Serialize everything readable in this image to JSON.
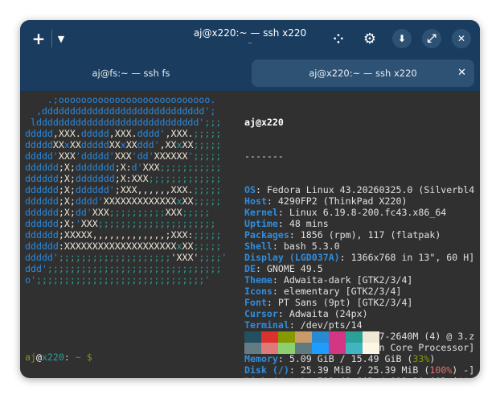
{
  "window": {
    "title": "aj@x220:~ — ssh x220",
    "subtitle": "~"
  },
  "toolbar": {
    "new_tab": "+",
    "menu": "▼",
    "grid": "⁘",
    "settings": "⚙",
    "download": "⬇",
    "fullscreen": "⤢",
    "close": "✕"
  },
  "tabs": [
    {
      "label": "aj@fs:~ — ssh fs",
      "active": false
    },
    {
      "label": "aj@x220:~ — ssh x220",
      "active": true,
      "close": "✕"
    }
  ],
  "logo": [
    [
      [
        "b",
        "    .;ooooooooooooooooooooooooooo."
      ]
    ],
    [
      [
        "b",
        "  ,ddddddddddddddddddddddddddddd';"
      ]
    ],
    [
      [
        "b",
        " lddddddddddddddddddddddddddddd'"
      ],
      [
        "t",
        ";;;"
      ]
    ],
    [
      [
        "b",
        "ddddd"
      ],
      [
        "w",
        ",XXX."
      ],
      [
        "b",
        "ddddd"
      ],
      [
        "w",
        ",XXX."
      ],
      [
        "b",
        "dddd'"
      ],
      [
        "w",
        ",XXX."
      ],
      [
        "t",
        ";;;;;"
      ]
    ],
    [
      [
        "b",
        "ddddd"
      ],
      [
        "w",
        "XX"
      ],
      [
        "b",
        "x"
      ],
      [
        "w",
        "XX"
      ],
      [
        "b",
        "ddddd"
      ],
      [
        "w",
        "XX"
      ],
      [
        "b",
        "x"
      ],
      [
        "w",
        "XX"
      ],
      [
        "b",
        "ddd'"
      ],
      [
        "w",
        ",XX"
      ],
      [
        "t",
        "x"
      ],
      [
        "w",
        "XX"
      ],
      [
        "t",
        ";;;;;"
      ]
    ],
    [
      [
        "b",
        "ddddd'"
      ],
      [
        "w",
        "XXX"
      ],
      [
        "b",
        "'ddddd'"
      ],
      [
        "w",
        "XXX"
      ],
      [
        "b",
        "'dd'"
      ],
      [
        "w",
        "XXXXXX"
      ],
      [
        "b",
        "'"
      ],
      [
        "t",
        ";;;;;"
      ]
    ],
    [
      [
        "b",
        "dddddd"
      ],
      [
        "w",
        ";X;"
      ],
      [
        "b",
        "ddddddd"
      ],
      [
        "w",
        ";X:"
      ],
      [
        "b",
        "d'"
      ],
      [
        "w",
        "XXX"
      ],
      [
        "t",
        ";;;;;;;;;;;"
      ]
    ],
    [
      [
        "b",
        "dddddd"
      ],
      [
        "w",
        ";X;"
      ],
      [
        "b",
        "ddddddd"
      ],
      [
        "w",
        ";X:XXX"
      ],
      [
        "t",
        ";;;;;;;;;;;;;"
      ]
    ],
    [
      [
        "b",
        "dddddd"
      ],
      [
        "w",
        ";X;"
      ],
      [
        "b",
        "dddddd'"
      ],
      [
        "w",
        ";XXX,,,,,,XXX."
      ],
      [
        "t",
        ";;;;;"
      ]
    ],
    [
      [
        "b",
        "dddddd"
      ],
      [
        "w",
        ";X;"
      ],
      [
        "b",
        "dddd'"
      ],
      [
        "w",
        "XXXXXXXXXXXXX"
      ],
      [
        "t",
        "x"
      ],
      [
        "w",
        "XX"
      ],
      [
        "t",
        ";;;;;"
      ]
    ],
    [
      [
        "b",
        "dddddd"
      ],
      [
        "w",
        ";X;"
      ],
      [
        "b",
        "dd'"
      ],
      [
        "w",
        "XXX"
      ],
      [
        "t",
        ";;;;;;;;;;"
      ],
      [
        "w",
        "XXX"
      ],
      [
        "t",
        ";;;;;"
      ]
    ],
    [
      [
        "b",
        "dddddd"
      ],
      [
        "w",
        ";X;"
      ],
      [
        "b",
        "'"
      ],
      [
        "w",
        "XXX"
      ],
      [
        "t",
        ";;;;;;;;;;;;;;;;;;;;;"
      ]
    ],
    [
      [
        "b",
        "dddddd"
      ],
      [
        "w",
        ";XXXXX,,,,,,,,,,,,,;XXX:"
      ],
      [
        "t",
        ";;;;;"
      ]
    ],
    [
      [
        "b",
        "dddddd"
      ],
      [
        "w",
        ":XXXXXXXXXXXXXXXXXXXX"
      ],
      [
        "t",
        "x"
      ],
      [
        "w",
        "XX"
      ],
      [
        "t",
        ";;;;;"
      ]
    ],
    [
      [
        "b",
        "ddddd'"
      ],
      [
        "t",
        ";;;;;;;;;;;;;;;;;;;;"
      ],
      [
        "w",
        "'XXX'"
      ],
      [
        "t",
        ";;;;"
      ],
      [
        "b",
        "'"
      ]
    ],
    [
      [
        "b",
        "ddd'"
      ],
      [
        "t",
        ";;;;;;;;;;;;;;;;;;;;;;;;;;;;;;;"
      ]
    ],
    [
      [
        "b",
        "o'"
      ],
      [
        "t",
        ";;;;;;;;;;;;;;;;;;;;;;;;;;;;;;"
      ],
      [
        "b",
        "'"
      ]
    ]
  ],
  "info": {
    "user_host": "aj@x220",
    "separator": "-------",
    "lines": [
      [
        [
          "k",
          "OS"
        ],
        [
          "n",
          ": Fedora Linux 43.20260325.0 (Silverbl4"
        ]
      ],
      [
        [
          "k",
          "Host"
        ],
        [
          "n",
          ": 4290FP2 (ThinkPad X220)"
        ]
      ],
      [
        [
          "k",
          "Kernel"
        ],
        [
          "n",
          ": Linux 6.19.8-200.fc43.x86_64"
        ]
      ],
      [
        [
          "k",
          "Uptime"
        ],
        [
          "n",
          ": 48 mins"
        ]
      ],
      [
        [
          "k",
          "Packages"
        ],
        [
          "n",
          ": 1856 (rpm), 117 (flatpak)"
        ]
      ],
      [
        [
          "k",
          "Shell"
        ],
        [
          "n",
          ": bash 5.3.0"
        ]
      ],
      [
        [
          "k",
          "Display (LGD037A)"
        ],
        [
          "n",
          ": 1366x768 in 13\", 60 H]"
        ]
      ],
      [
        [
          "k",
          "DE"
        ],
        [
          "n",
          ": GNOME 49.5"
        ]
      ],
      [
        [
          "k",
          "Theme"
        ],
        [
          "n",
          ": Adwaita-dark [GTK2/3/4]"
        ]
      ],
      [
        [
          "k",
          "Icons"
        ],
        [
          "n",
          ": elementary [GTK2/3/4]"
        ]
      ],
      [
        [
          "k",
          "Font"
        ],
        [
          "n",
          ": PT Sans (9pt) [GTK2/3/4]"
        ]
      ],
      [
        [
          "k",
          "Cursor"
        ],
        [
          "n",
          ": Adwaita (24px)"
        ]
      ],
      [
        [
          "k",
          "Terminal"
        ],
        [
          "n",
          ": /dev/pts/14"
        ]
      ],
      [
        [
          "k",
          "CPU"
        ],
        [
          "n",
          ": Intel(R) Core(TM) i7-2640M (4) @ 3.z"
        ]
      ],
      [
        [
          "k",
          "GPU"
        ],
        [
          "n",
          ": Intel 2nd Generation Core Processor]"
        ]
      ],
      [
        [
          "k",
          "Memory"
        ],
        [
          "n",
          ": 5.09 GiB / 15.49 GiB ("
        ],
        [
          "g",
          "33%"
        ],
        [
          "n",
          ")"
        ]
      ],
      [
        [
          "k",
          "Disk (/)"
        ],
        [
          "n",
          ": 25.39 MiB / 25.39 MiB ("
        ],
        [
          "r",
          "100%"
        ],
        [
          "n",
          ") -]"
        ]
      ],
      [
        [
          "k",
          "Disk (/etc)"
        ],
        [
          "n",
          ": 592.40 GiB / 892.28 GiB ("
        ],
        [
          "d",
          "66s"
        ]
      ]
    ]
  },
  "palette": [
    "#22505e",
    "#dc322f",
    "#859900",
    "#c99a6a",
    "#268bd2",
    "#d33682",
    "#2aa198",
    "#eee8d5",
    "#657b83",
    "#e07a7a",
    "#8cd070",
    "#5f7a80",
    "#1e9cff",
    "#d33682",
    "#40b4c0",
    "#fdf6e3"
  ],
  "prompt": {
    "user": "aj",
    "at": "@",
    "host": "x220",
    "colon": ": ",
    "cwd": "~",
    "sym": " $"
  }
}
